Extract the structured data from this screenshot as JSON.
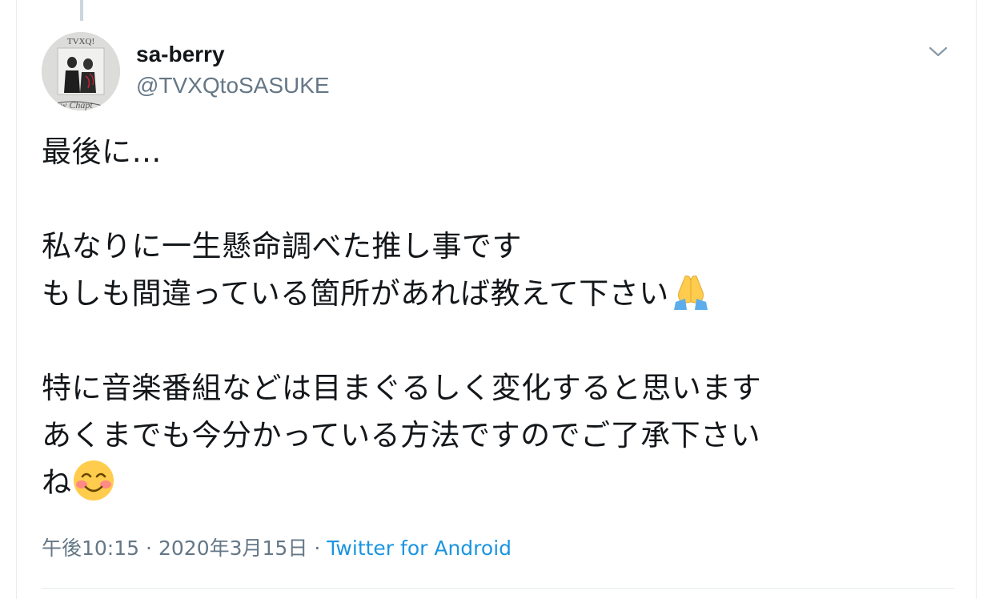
{
  "tweet": {
    "user": {
      "display_name": "sa-berry",
      "handle": "@TVXQtoSASUKE",
      "avatar_text": "TVXQ!"
    },
    "text_lines": {
      "l1": "最後に…",
      "l2": "私なりに一生懸命調べた推し事です",
      "l3": "もしも間違っている箇所があれば教えて下さい",
      "l4": "特に音楽番組などは目まぐるしく変化すると思います",
      "l5": "あくまでも今分かっている方法ですのでご了承下さい",
      "l6": "ね"
    },
    "emojis": {
      "pray": "folded-hands-emoji",
      "smile": "smiling-face-emoji"
    },
    "time": "午後10:15",
    "separator": "·",
    "date": "2020年3月15日",
    "source": "Twitter for Android"
  },
  "colors": {
    "text": "#14171a",
    "muted": "#657786",
    "link": "#1b95e0",
    "border": "#e6ecf0"
  },
  "icons": {
    "menu": "chevron-down-icon"
  }
}
